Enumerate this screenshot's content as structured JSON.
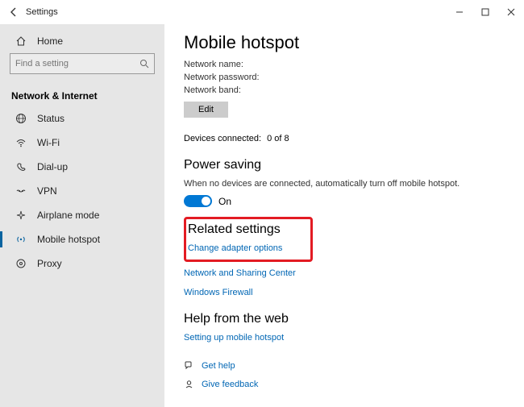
{
  "window": {
    "title": "Settings"
  },
  "sidebar": {
    "home_label": "Home",
    "search_placeholder": "Find a setting",
    "section": "Network & Internet",
    "items": [
      {
        "label": "Status"
      },
      {
        "label": "Wi-Fi"
      },
      {
        "label": "Dial-up"
      },
      {
        "label": "VPN"
      },
      {
        "label": "Airplane mode"
      },
      {
        "label": "Mobile hotspot"
      },
      {
        "label": "Proxy"
      }
    ]
  },
  "main": {
    "title": "Mobile hotspot",
    "name_label": "Network name:",
    "password_label": "Network password:",
    "band_label": "Network band:",
    "edit_label": "Edit",
    "devices_label": "Devices connected:",
    "devices_value": "0 of 8",
    "powersaving_title": "Power saving",
    "powersaving_desc": "When no devices are connected, automatically turn off mobile hotspot.",
    "toggle_state": "On",
    "related_title": "Related settings",
    "link_adapter": "Change adapter options",
    "link_sharing": "Network and Sharing Center",
    "link_firewall": "Windows Firewall",
    "webhelp_title": "Help from the web",
    "link_setup": "Setting up mobile hotspot",
    "get_help": "Get help",
    "give_feedback": "Give feedback"
  }
}
